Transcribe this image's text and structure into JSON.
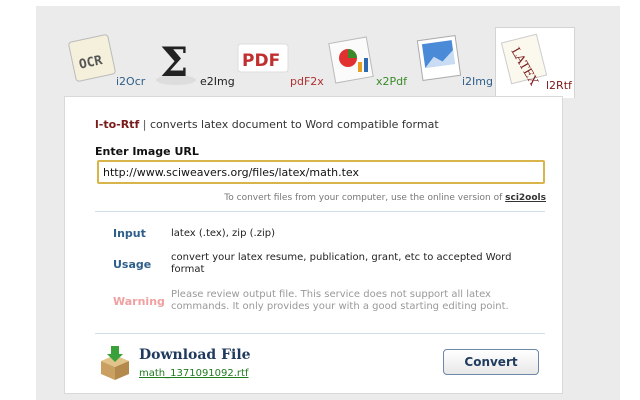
{
  "tabs": [
    {
      "name": "ocr-icon",
      "label": "i2Ocr",
      "icon_text": "OCR",
      "label_color": "#2e5e8a"
    },
    {
      "name": "sigma-icon",
      "label": "e2Img",
      "icon_text": "Σ",
      "label_color": "#222222"
    },
    {
      "name": "pdf-icon",
      "label": "pdF2x",
      "icon_text": "PDF",
      "label_color": "#b03030"
    },
    {
      "name": "chart-icon",
      "label": "x2Pdf",
      "icon_text": "",
      "label_color": "#3a8a2a"
    },
    {
      "name": "image-icon",
      "label": "i2Img",
      "icon_text": "",
      "label_color": "#2e5e8a"
    },
    {
      "name": "latex-icon",
      "label": "l2Rtf",
      "icon_text": "LATEX",
      "label_color": "#7a1a1a",
      "active": true
    }
  ],
  "heading": {
    "brand": "l-to-Rtf",
    "separator": "|",
    "description": "converts latex document to Word compatible format"
  },
  "url_field": {
    "label": "Enter Image URL",
    "value": "http://www.sciweavers.org/files/latex/math.tex"
  },
  "hint": {
    "text": "To convert files from your computer, use the online version of",
    "link": "sci2ools"
  },
  "info": {
    "input_label": "Input",
    "input_value": "latex (.tex), zip (.zip)",
    "usage_label": "Usage",
    "usage_value": "convert your latex resume, publication, grant, etc to accepted Word format",
    "warning_label": "Warning",
    "warning_value": "Please review output file. This service does not support all latex commands. It only provides your with a good starting editing point."
  },
  "download": {
    "title": "Download File",
    "file": "math_1371091092.rtf"
  },
  "convert_button": "Convert",
  "colors": {
    "brand": "#7a1a1a",
    "label_blue": "#2e5e8a",
    "warning": "#f0a0a0",
    "input_border": "#d8b54a"
  }
}
